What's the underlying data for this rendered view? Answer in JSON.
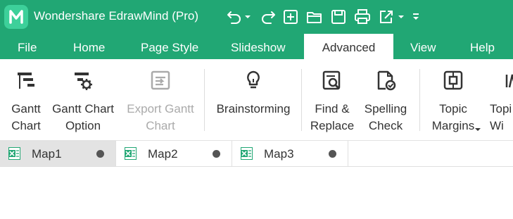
{
  "app": {
    "title": "Wondershare EdrawMind (Pro)",
    "accent": "#21a774"
  },
  "quick_access": [
    "undo-icon",
    "dropdown-icon",
    "redo-icon",
    "new-icon",
    "open-icon",
    "save-icon",
    "print-icon",
    "export-icon",
    "dropdown-icon",
    "customize-icon"
  ],
  "menu": {
    "file": "File",
    "home": "Home",
    "page_style": "Page Style",
    "slideshow": "Slideshow",
    "advanced": "Advanced",
    "view": "View",
    "help": "Help"
  },
  "ribbon": {
    "gantt_chart": "Gantt\nChart",
    "gantt_chart_option": "Gantt Chart\nOption",
    "export_gantt_chart": "Export Gantt\nChart",
    "brainstorming": "Brainstorming",
    "find_replace": "Find &\nReplace",
    "spelling_check": "Spelling\nCheck",
    "topic_margins": "Topic\nMargins",
    "topic_width": "Topi\nWi"
  },
  "doc_tabs": [
    {
      "name": "Map1",
      "active": true
    },
    {
      "name": "Map2",
      "active": false
    },
    {
      "name": "Map3",
      "active": false
    }
  ]
}
